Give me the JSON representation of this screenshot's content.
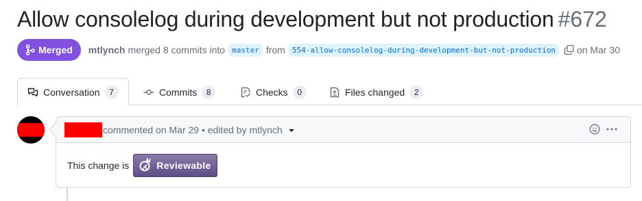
{
  "pr": {
    "title": "Allow consolelog during development but not production",
    "number": "#672",
    "status": "Merged",
    "author": "mtlynch",
    "merged_text": "merged 8 commits into",
    "base_branch": "master",
    "from_text": "from",
    "head_branch": "554-allow-consolelog-during-development-but-not-production",
    "date_text": "on Mar 30"
  },
  "tabs": [
    {
      "label": "Conversation",
      "count": "7",
      "icon": "comment-discussion-icon"
    },
    {
      "label": "Commits",
      "count": "8",
      "icon": "git-commit-icon"
    },
    {
      "label": "Checks",
      "count": "0",
      "icon": "checklist-icon"
    },
    {
      "label": "Files changed",
      "count": "2",
      "icon": "file-diff-icon"
    }
  ],
  "comment": {
    "header_text": "commented on Mar 29 • edited by mtlynch",
    "body_text": "This change is",
    "badge_label": "Reviewable"
  },
  "colors": {
    "merged": "#8250df",
    "branch_bg": "#ddf4ff",
    "branch_text": "#0969da",
    "redaction": "#ff0000"
  }
}
